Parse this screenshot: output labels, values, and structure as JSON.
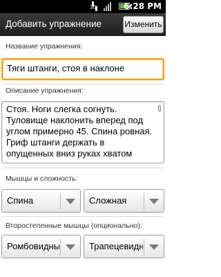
{
  "status_bar": {
    "network_label": "3G",
    "time": "6:28 PM",
    "icons": [
      "network-3g-icon",
      "signal-icon",
      "battery-icon"
    ]
  },
  "titlebar": {
    "title": "Добавить упражнение",
    "edit_button": "Изменить"
  },
  "form": {
    "name_label": "Название упражнения:",
    "name_value": "Тяги штанги, стоя в наклоне",
    "description_label": "Описание упражнения:",
    "description_value": "Стоя. Ноги слегка согнуть. Туловище наклонить вперед под углом примерно 45. Спина ровная. Гриф штанги держать в опущенных вниз руках хватом",
    "muscles_label": "Мышцы и сложность:",
    "muscle_value": "Спина",
    "difficulty_value": "Сложная",
    "secondary_label": "Второстепенные мышцы (опционально):",
    "secondary_1_value": "Ромбовидны",
    "secondary_2_value": "Трапецевидн"
  },
  "colors": {
    "focus_border": "#ff9d00",
    "title_bar": "#2a2a2a"
  }
}
